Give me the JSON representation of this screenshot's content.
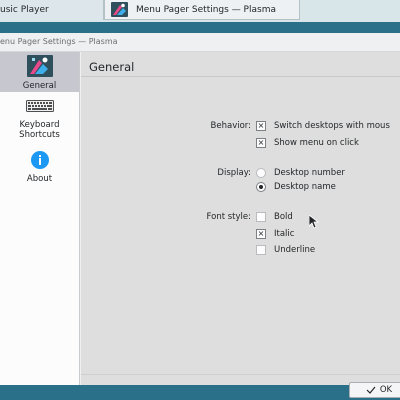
{
  "taskbar": {
    "tasks": [
      {
        "label": "usic Player"
      },
      {
        "label": "Menu Pager Settings — Plasma"
      }
    ]
  },
  "window": {
    "title": "enu Pager Settings — Plasma"
  },
  "sidebar": {
    "items": [
      {
        "label": "General",
        "icon": "general-settings-icon",
        "active": true
      },
      {
        "label": "Keyboard Shortcuts",
        "icon": "keyboard-icon"
      },
      {
        "label": "About",
        "icon": "info-icon"
      }
    ]
  },
  "main": {
    "title": "General",
    "behavior": {
      "label": "Behavior:",
      "options": [
        {
          "label": "Switch desktops with mous",
          "checked": true
        },
        {
          "label": "Show menu on click",
          "checked": true
        }
      ]
    },
    "display": {
      "label": "Display:",
      "options": [
        {
          "label": "Desktop number",
          "selected": false
        },
        {
          "label": "Desktop name",
          "selected": true
        }
      ]
    },
    "font_style": {
      "label": "Font style:",
      "options": [
        {
          "label": "Bold",
          "checked": false
        },
        {
          "label": "Italic",
          "checked": true
        },
        {
          "label": "Underline",
          "checked": false
        }
      ]
    },
    "ok_label": "OK"
  },
  "glyphs": {
    "check": "×"
  }
}
